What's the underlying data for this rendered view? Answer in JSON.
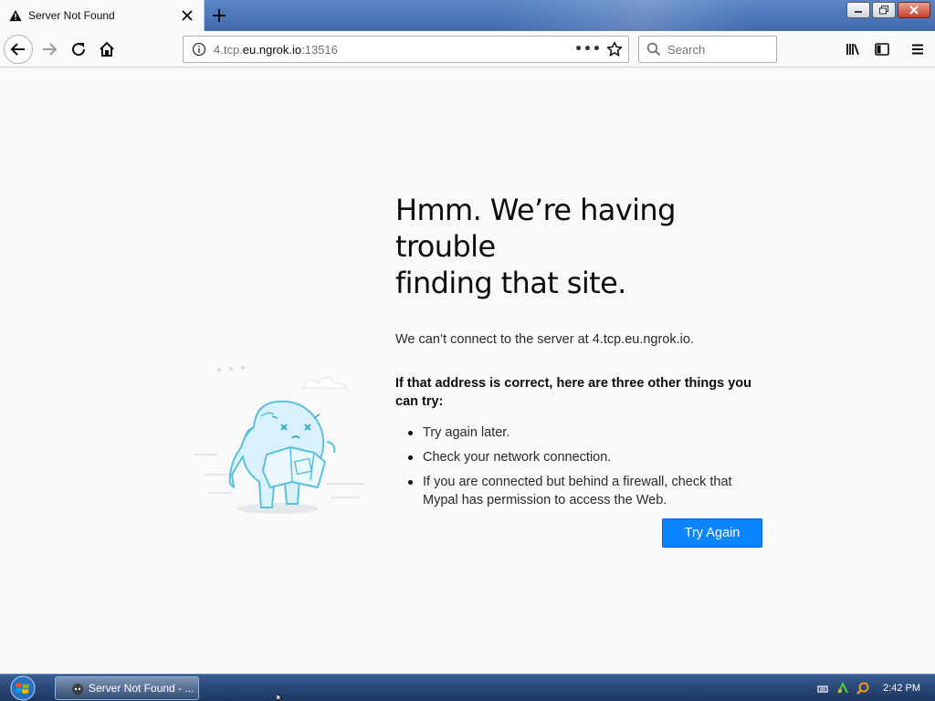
{
  "tab": {
    "title": "Server Not Found"
  },
  "url_bar": {
    "prefix": "4.tcp.",
    "host": "eu.ngrok.io",
    "suffix": ":13516"
  },
  "search": {
    "placeholder": "Search"
  },
  "error": {
    "heading_line1": "Hmm. We’re having trouble",
    "heading_line2": "finding that site.",
    "description": "We can’t connect to the server at 4.tcp.eu.ngrok.io.",
    "tips_title": "If that address is correct, here are three other things you can try:",
    "tips": [
      "Try again later.",
      "Check your network connection.",
      "If you are connected but behind a firewall, check that Mypal has permission to access the Web."
    ],
    "try_again_label": "Try Again"
  },
  "taskbar": {
    "task_label": "Server Not Found - ...",
    "clock": "2:42 PM"
  },
  "colors": {
    "accent": "#0a84ff",
    "illustration": "#5bc0de"
  }
}
